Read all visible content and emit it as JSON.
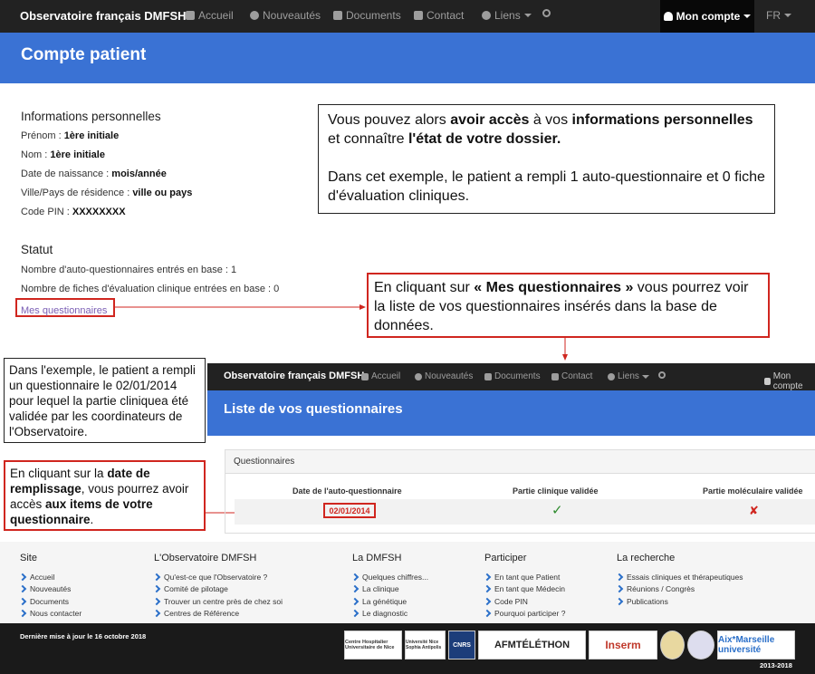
{
  "nav": {
    "brand": "Observatoire français DMFSH",
    "items": [
      "Accueil",
      "Nouveautés",
      "Documents",
      "Contact",
      "Liens",
      ""
    ],
    "account": "Mon compte",
    "lang": "FR"
  },
  "page_title": "Compte patient",
  "personal": {
    "heading": "Informations personnelles",
    "rows": [
      {
        "label": "Prénom : ",
        "value": "1ère initiale"
      },
      {
        "label": "Nom : ",
        "value": "1ère initiale"
      },
      {
        "label": "Date de naissance : ",
        "value": "mois/année"
      },
      {
        "label": "Ville/Pays de résidence : ",
        "value": "ville ou pays"
      },
      {
        "label": "Code PIN : ",
        "value": "XXXXXXXX"
      }
    ]
  },
  "status": {
    "heading": "Statut",
    "auto_count": "Nombre d'auto-questionnaires entrés en base : 1",
    "clinical_count": "Nombre de fiches d'évaluation clinique entrées en base : 0",
    "link": "Mes questionnaires"
  },
  "callouts": {
    "top_1": "Vous pouvez alors ",
    "top_2": "avoir accès",
    "top_3": " à vos ",
    "top_4": "informations personnelles",
    "top_5": " et connaître ",
    "top_6": "l'état de votre dossier.",
    "top_7": "Dans cet exemple, le patient a rempli 1 auto-questionnaire et 0 fiche d'évaluation cliniques.",
    "mid_1": "En cliquant sur ",
    "mid_2": "« Mes questionnaires »",
    "mid_3": " vous pourrez voir la liste de vos questionnaires insérés dans la base de données.",
    "left_1": "Dans l'exemple, le patient a rempli un questionnaire le 02/01/2014 pour lequel la partie cliniquea été validée par les coordinateurs de l'Observatoire.",
    "left2_1": "En cliquant sur la ",
    "left2_2": "date de remplissage",
    "left2_3": ", vous pourrez avoir accès ",
    "left2_4": "aux items de votre questionnaire",
    "left2_5": "."
  },
  "inset": {
    "brand": "Observatoire français DMFSH",
    "items": [
      "Accueil",
      "Nouveautés",
      "Documents",
      "Contact",
      "Liens"
    ],
    "account": "Mon compte",
    "title": "Liste de vos questionnaires",
    "panel_title": "Questionnaires",
    "columns": [
      "Date de l'auto-questionnaire",
      "Partie clinique validée",
      "Partie moléculaire validée"
    ],
    "row": {
      "date": "02/01/2014",
      "clinical": "✓",
      "molecular": "✘"
    }
  },
  "footer": {
    "cols": [
      {
        "h": "Site",
        "items": [
          "Accueil",
          "Nouveautés",
          "Documents",
          "Nous contacter"
        ]
      },
      {
        "h": "L'Observatoire DMFSH",
        "items": [
          "Qu'est-ce que l'Observatoire ?",
          "Comité de pilotage",
          "Trouver un centre près de chez soi",
          "Centres de Référence"
        ]
      },
      {
        "h": "La DMFSH",
        "items": [
          "Quelques chiffres...",
          "La clinique",
          "La génétique",
          "Le diagnostic"
        ]
      },
      {
        "h": "Participer",
        "items": [
          "En tant que Patient",
          "En tant que Médecin",
          "Code PIN",
          "Pourquoi participer ?"
        ]
      },
      {
        "h": "La recherche",
        "items": [
          "Essais cliniques et thérapeutiques",
          "Réunions / Congrès",
          "Publications"
        ]
      }
    ],
    "updated": "Dernière mise à jour le 16 octobre 2018",
    "years": "2013-2018",
    "logos": [
      "Centre Hospitalier Universitaire de Nice",
      "Université Nice Sophia Antipolis",
      "CNRS",
      "AFMTÉLÉTHON",
      "Inserm",
      "",
      "",
      "Aix*Marseille université"
    ]
  },
  "colors": {
    "navbar": "#222222",
    "band": "#3a72d4",
    "accent_red": "#d0261f",
    "check": "#2e8b2e"
  }
}
